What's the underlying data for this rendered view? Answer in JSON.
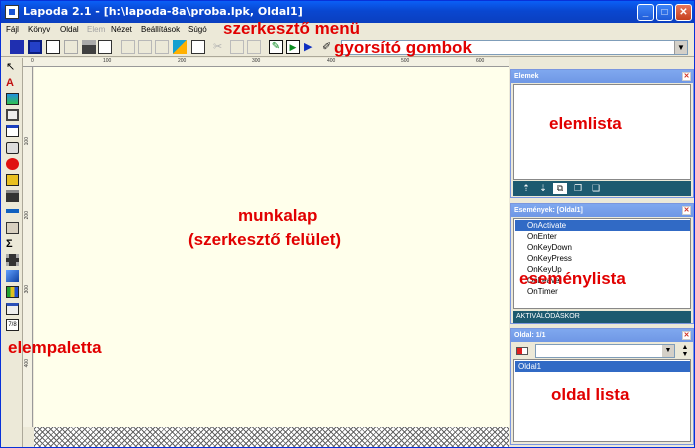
{
  "window": {
    "title": "Lapoda 2.1 - [h:\\lapoda-8a\\proba.lpk, Oldal1]",
    "minimize_glyph": "_",
    "maximize_glyph": "□",
    "close_glyph": "✕"
  },
  "menu": {
    "items": [
      {
        "label": "Fájl",
        "enabled": true
      },
      {
        "label": "Könyv",
        "enabled": true
      },
      {
        "label": "Oldal",
        "enabled": true
      },
      {
        "label": "Elem",
        "enabled": false
      },
      {
        "label": "Nézet",
        "enabled": true
      },
      {
        "label": "Beállítások",
        "enabled": true
      },
      {
        "label": "Súgó",
        "enabled": true
      }
    ]
  },
  "toolbar": {
    "buttons": [
      "new-book-icon",
      "open-icon",
      "blank-page-icon",
      "save-icon",
      "print-icon",
      "preview-icon",
      "align-left-icon",
      "align-center-icon",
      "align-right-icon",
      "cut-icon",
      "copy-icon",
      "paste-icon",
      "run-icon",
      "properties-icon",
      "edit-icon",
      "play-icon",
      "play-arrow-icon",
      "pen-icon"
    ],
    "combo_value": ""
  },
  "palette": {
    "tools": [
      "pointer-icon",
      "text-icon",
      "image-icon",
      "picture-frame-icon",
      "window-icon",
      "button-icon",
      "ellipse-icon",
      "sound-icon",
      "video-icon",
      "line-icon",
      "animation-icon",
      "sum-icon",
      "film-icon",
      "cube-icon",
      "chart-icon",
      "list-icon",
      "edit-field-icon"
    ]
  },
  "rulers": {
    "horizontal_ticks": [
      "0",
      "100",
      "200",
      "300",
      "400",
      "500",
      "600",
      "700"
    ],
    "vertical_ticks": [
      "100",
      "200",
      "300",
      "400"
    ]
  },
  "panels": {
    "elements": {
      "title": "Elemek",
      "toolbar_icons": [
        "bring-forward-icon",
        "send-backward-icon",
        "group-icon",
        "copy-layer-icon",
        "paste-layer-icon"
      ]
    },
    "events": {
      "title": "Események: [Oldal1]",
      "items": [
        "OnActivate",
        "OnEnter",
        "OnKeyDown",
        "OnKeyPress",
        "OnKeyUp",
        "OnLeave",
        "OnTimer"
      ],
      "selected_index": 0,
      "status": "AKTIVÁLÓDÁSKOR"
    },
    "pages": {
      "title": "Oldal: 1/1",
      "select_value": "",
      "items": [
        "Oldal1"
      ]
    }
  },
  "annotations": {
    "menu": "szerkesztő menü",
    "toolbar": "gyorsító gombok",
    "element_list": "elemlista",
    "worksheet_line1": "munkalap",
    "worksheet_line2": "(szerkesztő felület)",
    "event_list": "eseménylista",
    "palette": "elempaletta",
    "page_list": "oldal lista"
  },
  "colors": {
    "annotation": "#e10000",
    "titlebar": "#0947d0",
    "panel_header": "#7fa8ef",
    "selection": "#316ac5",
    "worksheet": "#ffffeb"
  }
}
